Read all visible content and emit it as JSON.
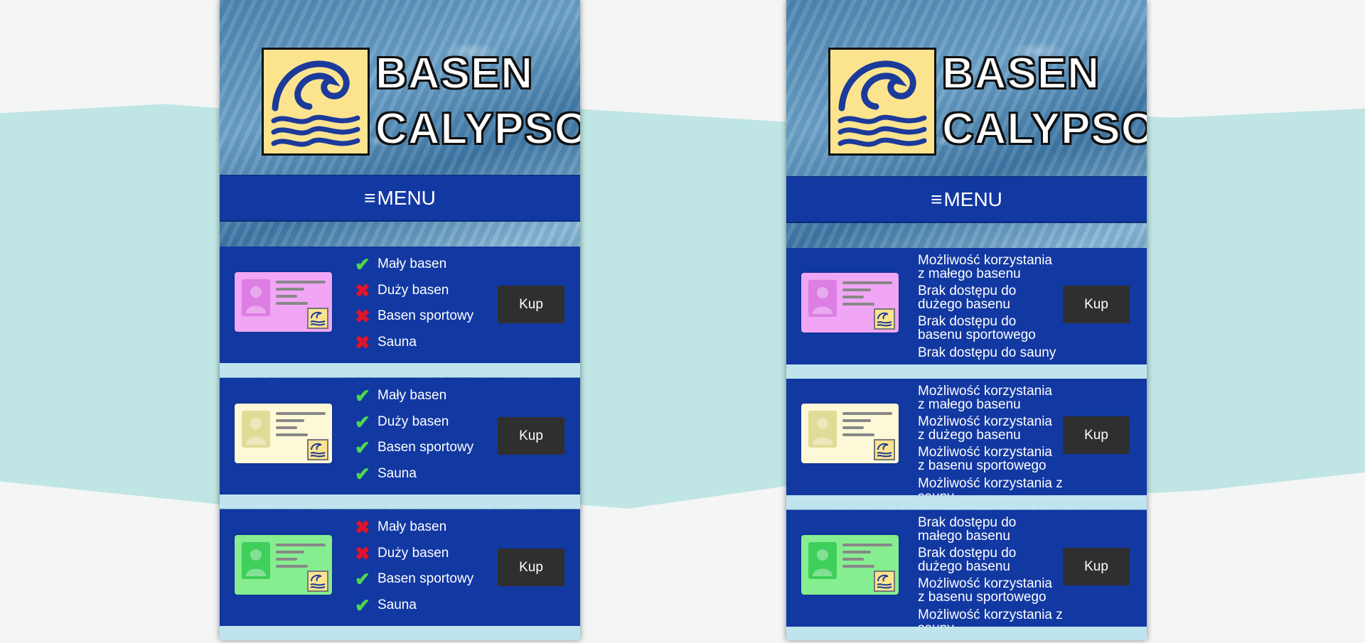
{
  "site": {
    "logo_line1": "BASEN",
    "logo_line2": "CALYPSO",
    "menu_label": "MENU",
    "menu_icon": "hamburger-icon"
  },
  "buy_label": "Kup",
  "colors": {
    "nav_blue": "#1238a2",
    "logo_yellow": "#fce48f",
    "wave_blue": "#1b3a9a",
    "check_green": "#4ed84c",
    "cross_red": "#e0142a",
    "button_dark": "#2f2f2f",
    "pass_pink": "#f0a6f4",
    "pass_cream": "#fdf9d8",
    "pass_green": "#86ee90"
  },
  "left_panel": {
    "passes": [
      {
        "pass_color": "pink",
        "features": [
          {
            "label": "Mały basen",
            "icon": "check-icon"
          },
          {
            "label": "Duży basen",
            "icon": "cross-icon"
          },
          {
            "label": "Basen sportowy",
            "icon": "cross-icon"
          },
          {
            "label": "Sauna",
            "icon": "cross-icon"
          }
        ]
      },
      {
        "pass_color": "cream",
        "features": [
          {
            "label": "Mały basen",
            "icon": "check-icon"
          },
          {
            "label": "Duży basen",
            "icon": "check-icon"
          },
          {
            "label": "Basen sportowy",
            "icon": "check-icon"
          },
          {
            "label": "Sauna",
            "icon": "check-icon"
          }
        ]
      },
      {
        "pass_color": "green",
        "features": [
          {
            "label": "Mały basen",
            "icon": "cross-icon"
          },
          {
            "label": "Duży basen",
            "icon": "cross-icon"
          },
          {
            "label": "Basen sportowy",
            "icon": "check-icon"
          },
          {
            "label": "Sauna",
            "icon": "check-icon"
          }
        ]
      }
    ]
  },
  "right_panel": {
    "passes": [
      {
        "pass_color": "pink",
        "descriptions": [
          "Możliwość korzystania\nz małego basenu",
          "Brak dostępu do\ndużego basenu",
          "Brak dostępu do\nbasenu sportowego",
          "Brak dostępu do sauny"
        ]
      },
      {
        "pass_color": "cream",
        "descriptions": [
          "Możliwość korzystania\nz małego basenu",
          "Możliwość korzystania\nz dużego basenu",
          "Możliwość korzystania\nz basenu sportowego",
          "Możliwość korzystania z sauny"
        ]
      },
      {
        "pass_color": "green",
        "descriptions": [
          "Brak dostępu do\nmałego basenu",
          "Brak dostępu do\ndużego basenu",
          "Możliwość korzystania\nz basenu sportowego",
          "Możliwość korzystania z sauny"
        ]
      }
    ]
  }
}
